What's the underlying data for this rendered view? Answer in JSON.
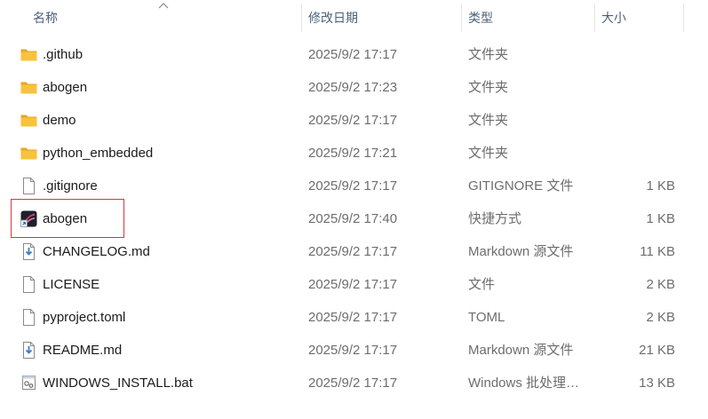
{
  "columns": {
    "name": "名称",
    "date": "修改日期",
    "type": "类型",
    "size": "大小"
  },
  "files": [
    {
      "name": ".github",
      "date": "2025/9/2 17:17",
      "type": "文件夹",
      "size": "",
      "icon": "folder-icon"
    },
    {
      "name": "abogen",
      "date": "2025/9/2 17:23",
      "type": "文件夹",
      "size": "",
      "icon": "folder-icon"
    },
    {
      "name": "demo",
      "date": "2025/9/2 17:17",
      "type": "文件夹",
      "size": "",
      "icon": "folder-icon"
    },
    {
      "name": "python_embedded",
      "date": "2025/9/2 17:21",
      "type": "文件夹",
      "size": "",
      "icon": "folder-icon"
    },
    {
      "name": ".gitignore",
      "date": "2025/9/2 17:17",
      "type": "GITIGNORE 文件",
      "size": "1 KB",
      "icon": "blank-file-icon"
    },
    {
      "name": "abogen",
      "date": "2025/9/2 17:40",
      "type": "快捷方式",
      "size": "1 KB",
      "icon": "shortcut-icon"
    },
    {
      "name": "CHANGELOG.md",
      "date": "2025/9/2 17:17",
      "type": "Markdown 源文件",
      "size": "11 KB",
      "icon": "markdown-file-icon"
    },
    {
      "name": "LICENSE",
      "date": "2025/9/2 17:17",
      "type": "文件",
      "size": "2 KB",
      "icon": "blank-file-icon"
    },
    {
      "name": "pyproject.toml",
      "date": "2025/9/2 17:17",
      "type": "TOML",
      "size": "2 KB",
      "icon": "blank-file-icon"
    },
    {
      "name": "README.md",
      "date": "2025/9/2 17:17",
      "type": "Markdown 源文件",
      "size": "21 KB",
      "icon": "markdown-file-icon"
    },
    {
      "name": "WINDOWS_INSTALL.bat",
      "date": "2025/9/2 17:17",
      "type": "Windows 批处理…",
      "size": "13 KB",
      "icon": "batch-file-icon"
    }
  ],
  "colors": {
    "folder": "#f8c33c",
    "highlight_border": "#d9363e",
    "header_text": "#4c607a"
  }
}
